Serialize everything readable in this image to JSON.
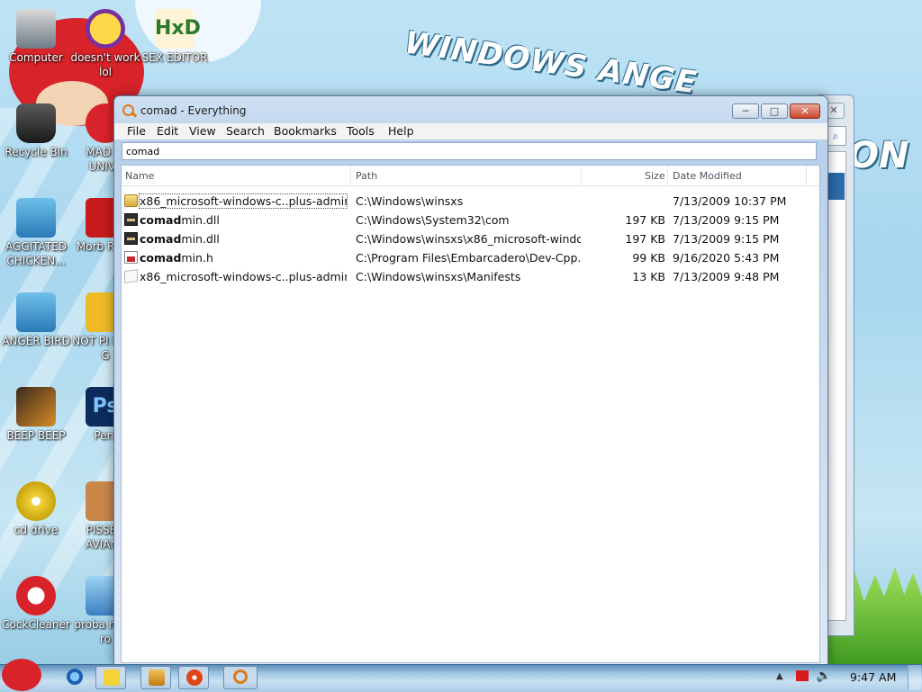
{
  "desktop": {
    "icons": [
      {
        "label": "Computer"
      },
      {
        "label": "doesn't work lol"
      },
      {
        "label": "SEX EDITOR"
      },
      {
        "label": "Recycle Bin"
      },
      {
        "label": "MAD BI UNIVE"
      },
      {
        "label": "AGGITATED CHICKEN..."
      },
      {
        "label": "Morb Read"
      },
      {
        "label": "ANGER BIRD"
      },
      {
        "label": "NOT PI BIRD G"
      },
      {
        "label": "BEEP BEEP"
      },
      {
        "label": "Peni"
      },
      {
        "label": "cd drive"
      },
      {
        "label": "PISSED AVIANS"
      },
      {
        "label": "CockCleaner"
      },
      {
        "label": "proba not a ro"
      }
    ]
  },
  "window": {
    "title": "comad - Everything",
    "buttons": {
      "minimize": "─",
      "maximize": "□",
      "close": "✕"
    },
    "menu": [
      "File",
      "Edit",
      "View",
      "Search",
      "Bookmarks",
      "Tools",
      "Help"
    ],
    "search_value": "comad",
    "columns": {
      "name": "Name",
      "path": "Path",
      "size": "Size",
      "date": "Date Modified"
    },
    "rows": [
      {
        "name_pre": "",
        "name_hl": "",
        "name_post": "x86_microsoft-windows-c..plus-admin-...",
        "path": "C:\\Windows\\winsxs",
        "size": "",
        "date": "7/13/2009 10:37 PM",
        "icon": "folder-icon"
      },
      {
        "name_pre": "",
        "name_hl": "comad",
        "name_post": "min.dll",
        "path": "C:\\Windows\\System32\\com",
        "size": "197 KB",
        "date": "7/13/2009 9:15 PM",
        "icon": "dll-file-icon"
      },
      {
        "name_pre": "",
        "name_hl": "comad",
        "name_post": "min.dll",
        "path": "C:\\Windows\\winsxs\\x86_microsoft-windo...",
        "size": "197 KB",
        "date": "7/13/2009 9:15 PM",
        "icon": "dll-file-icon"
      },
      {
        "name_pre": "",
        "name_hl": "comad",
        "name_post": "min.h",
        "path": "C:\\Program Files\\Embarcadero\\Dev-Cpp...",
        "size": "99 KB",
        "date": "9/16/2020 5:43 PM",
        "icon": "header-file-icon"
      },
      {
        "name_pre": "",
        "name_hl": "",
        "name_post": "x86_microsoft-windows-c..plus-admin-...",
        "path": "C:\\Windows\\winsxs\\Manifests",
        "size": "13 KB",
        "date": "7/13/2009 9:48 PM",
        "icon": "manifest-file-icon"
      }
    ]
  },
  "wallpaper": {
    "text1": "WINDOWS ANGE",
    "text2": "ON"
  },
  "taskbar": {
    "clock": "9:47 AM"
  }
}
